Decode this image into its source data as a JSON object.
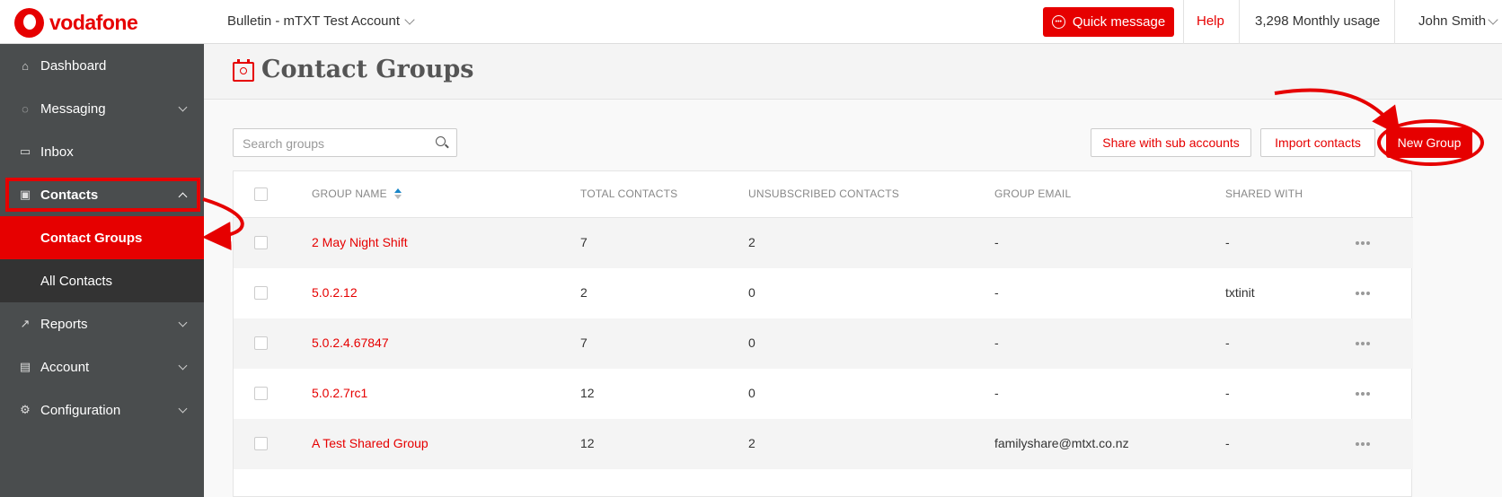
{
  "app": {
    "brand": "vodafone",
    "brand_color": "#e60000"
  },
  "topbar": {
    "account_name": "Bulletin - mTXT Test Account",
    "quick_message_label": "Quick message",
    "help_label": "Help",
    "usage_label": "3,298 Monthly usage",
    "user_name": "John Smith"
  },
  "sidebar": {
    "items": [
      {
        "label": "Dashboard",
        "icon": "home-icon"
      },
      {
        "label": "Messaging",
        "icon": "chat-icon"
      },
      {
        "label": "Inbox",
        "icon": "inbox-icon"
      },
      {
        "label": "Contacts",
        "icon": "contacts-icon"
      },
      {
        "label": "Reports",
        "icon": "chart-icon"
      },
      {
        "label": "Account",
        "icon": "account-icon"
      },
      {
        "label": "Configuration",
        "icon": "gear-icon"
      }
    ],
    "contacts_sub": [
      "Contact Groups",
      "All Contacts"
    ]
  },
  "page": {
    "title": "Contact Groups"
  },
  "toolbar": {
    "search_placeholder": "Search groups",
    "share_label": "Share with sub accounts",
    "import_label": "Import contacts",
    "new_group_label": "New Group"
  },
  "table": {
    "headers": [
      "GROUP NAME",
      "TOTAL CONTACTS",
      "UNSUBSCRIBED CONTACTS",
      "GROUP EMAIL",
      "SHARED WITH"
    ],
    "rows": [
      {
        "name": "2 May Night Shift",
        "total": "7",
        "unsubscribed": "2",
        "email": "-",
        "shared": "-"
      },
      {
        "name": "5.0.2.12",
        "total": "2",
        "unsubscribed": "0",
        "email": "-",
        "shared": "txtinit"
      },
      {
        "name": "5.0.2.4.67847",
        "total": "7",
        "unsubscribed": "0",
        "email": "-",
        "shared": "-"
      },
      {
        "name": "5.0.2.7rc1",
        "total": "12",
        "unsubscribed": "0",
        "email": "-",
        "shared": "-"
      },
      {
        "name": "A Test Shared Group",
        "total": "12",
        "unsubscribed": "2",
        "email": "familyshare@mtxt.co.nz",
        "shared": "-"
      }
    ]
  }
}
